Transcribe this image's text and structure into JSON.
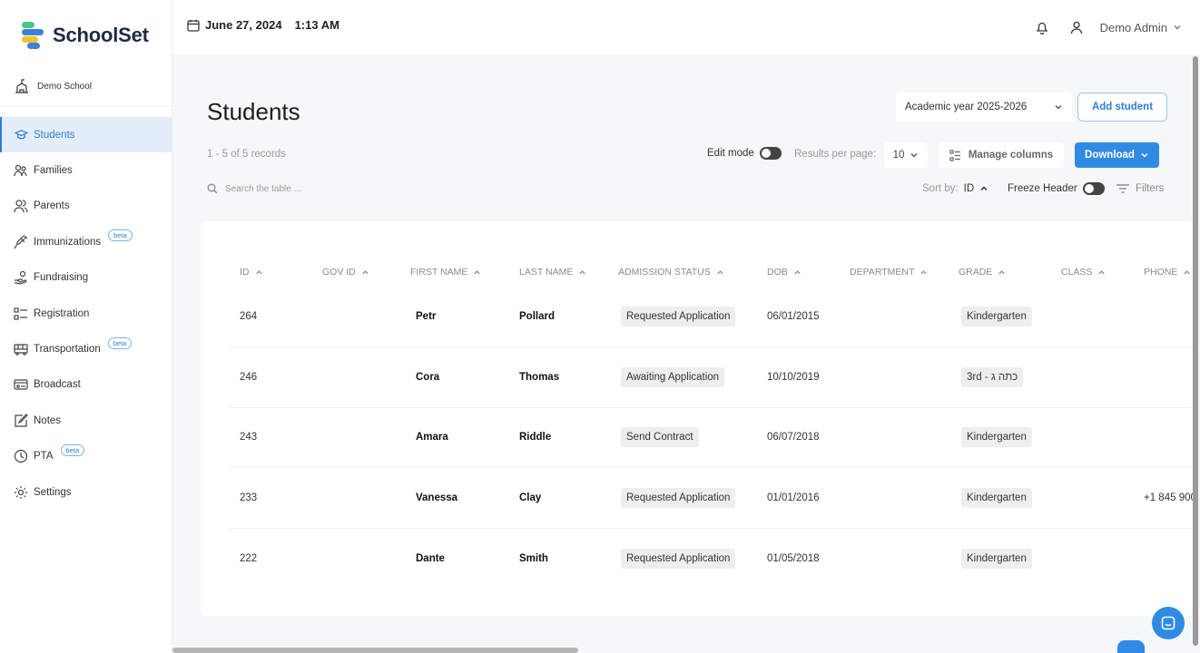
{
  "app": {
    "logo_text": "SchoolSet",
    "school_name": "Demo School"
  },
  "sidebar": {
    "items": [
      {
        "label": "Students",
        "icon": "graduation-cap-icon",
        "active": true
      },
      {
        "label": "Families",
        "icon": "family-icon"
      },
      {
        "label": "Parents",
        "icon": "parents-icon"
      },
      {
        "label": "Immunizations",
        "icon": "syringe-icon",
        "badge": "beta"
      },
      {
        "label": "Fundraising",
        "icon": "hand-coin-icon"
      },
      {
        "label": "Registration",
        "icon": "checklist-icon"
      },
      {
        "label": "Transportation",
        "icon": "bus-icon",
        "badge": "beta"
      },
      {
        "label": "Broadcast",
        "icon": "broadcast-icon"
      },
      {
        "label": "Notes",
        "icon": "notes-icon"
      },
      {
        "label": "PTA",
        "icon": "pta-icon",
        "badge": "beta"
      },
      {
        "label": "Settings",
        "icon": "gear-icon"
      }
    ]
  },
  "header": {
    "date": "June 27, 2024",
    "time": "1:13 AM",
    "user": "Demo Admin"
  },
  "page": {
    "title": "Students",
    "academic_year": "Academic year 2025-2026",
    "add_label": "Add student",
    "records": "1 - 5 of 5 records",
    "edit_mode_label": "Edit mode",
    "results_per_page_label": "Results per page:",
    "results_per_page": "10",
    "manage_columns_label": "Manage columns",
    "download_label": "Download",
    "search_placeholder": "Search the table ...",
    "sort_by_label": "Sort by:",
    "sort_by_value": "ID",
    "freeze_header_label": "Freeze Header",
    "filters_label": "Filters"
  },
  "table": {
    "columns": [
      "ID",
      "GOV ID",
      "FIRST NAME",
      "LAST NAME",
      "ADMISSION STATUS",
      "DOB",
      "DEPARTMENT",
      "GRADE",
      "CLASS",
      "PHONE"
    ],
    "rows": [
      {
        "id": "264",
        "gov_id": "",
        "first": "Petr",
        "last": "Pollard",
        "status": "Requested Application",
        "dob": "06/01/2015",
        "department": "",
        "grade": "Kindergarten",
        "class": "",
        "phone": ""
      },
      {
        "id": "246",
        "gov_id": "",
        "first": "Cora",
        "last": "Thomas",
        "status": "Awaiting Application",
        "dob": "10/10/2019",
        "department": "",
        "grade": "3rd - כתה ג",
        "class": "",
        "phone": ""
      },
      {
        "id": "243",
        "gov_id": "",
        "first": "Amara",
        "last": "Riddle",
        "status": "Send Contract",
        "dob": "06/07/2018",
        "department": "",
        "grade": "Kindergarten",
        "class": "",
        "phone": ""
      },
      {
        "id": "233",
        "gov_id": "",
        "first": "Vanessa",
        "last": "Clay",
        "status": "Requested Application",
        "dob": "01/01/2016",
        "department": "",
        "grade": "Kindergarten",
        "class": "",
        "phone": "+1 845 900"
      },
      {
        "id": "222",
        "gov_id": "",
        "first": "Dante",
        "last": "Smith",
        "status": "Requested Application",
        "dob": "01/05/2018",
        "department": "",
        "grade": "Kindergarten",
        "class": "",
        "phone": ""
      }
    ]
  },
  "colors": {
    "accent": "#2f8ae3",
    "active_bg": "#e3eef9",
    "logo_blue": "#3b82d6",
    "logo_green": "#4cc38a",
    "logo_yellow": "#f2c230"
  }
}
